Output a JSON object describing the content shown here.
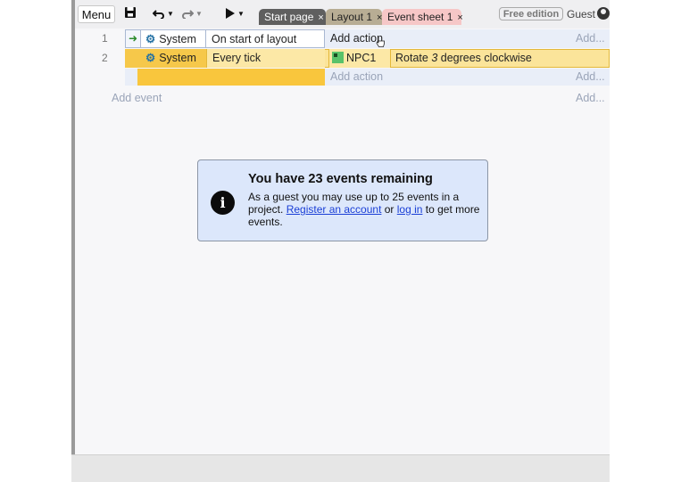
{
  "toolbar": {
    "menu_label": "Menu",
    "tabs": [
      {
        "label": "Start page",
        "close": "×"
      },
      {
        "label": "Layout 1",
        "close": "×"
      },
      {
        "label": "Event sheet 1",
        "close": "×"
      }
    ],
    "edition_badge": "Free edition",
    "user_label": "Guest"
  },
  "events": [
    {
      "number": "1",
      "object": "System",
      "condition": "On start of layout",
      "action_placeholder": "Add action",
      "add_label": "Add..."
    },
    {
      "number": "2",
      "object": "System",
      "condition": "Every tick",
      "action_object": "NPC1",
      "action_text_pre": "Rotate ",
      "action_value": "3",
      "action_text_post": " degrees clockwise",
      "add_action_label": "Add action",
      "add_label": "Add..."
    }
  ],
  "add_event_label": "Add event",
  "add_bottom_label": "Add...",
  "dialog": {
    "title": "You have 23 events remaining",
    "text_1": "As a guest you may use up to 25 events in a project. ",
    "link_register": "Register an account",
    "text_2": " or ",
    "link_login": "log in",
    "text_3": " to get more events."
  },
  "colors": {
    "selected_event_bg": "#fbe49a",
    "selected_event_margin": "#f6c84a",
    "dialog_bg": "#dce7fb",
    "link": "#1a3fd6"
  }
}
